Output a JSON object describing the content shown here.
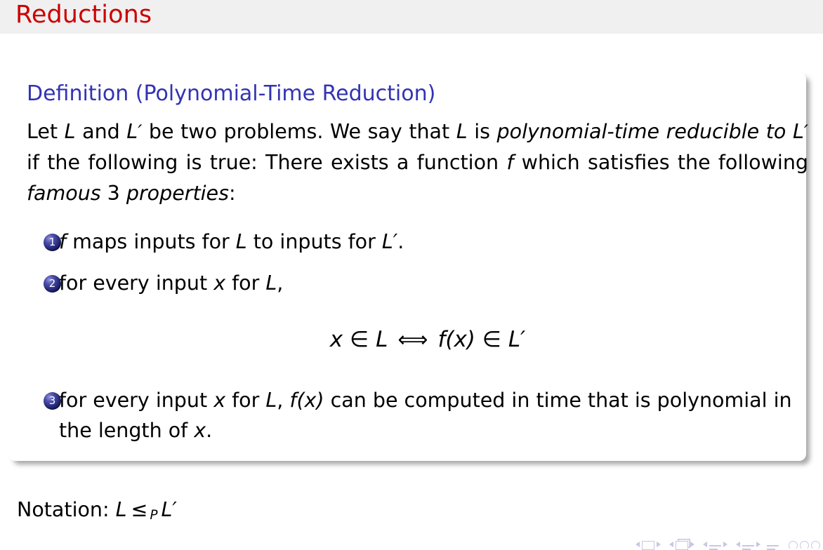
{
  "slide": {
    "title": "Reductions",
    "title_color": "#cc0000",
    "titlebar_bg": "#f0f0f0"
  },
  "block": {
    "heading": "Definition (Polynomial-Time Reduction)",
    "heading_color": "#3333b3",
    "paragraph": {
      "part1": "Let ",
      "L1": "L",
      "part2": " and ",
      "L2": "L",
      "prime2": "′",
      "part3": " be two problems.  We say that ",
      "L3": "L",
      "part4": " is ",
      "emph1": "polynomial-time reducible to",
      "part5": " ",
      "L4": "L",
      "prime4": "′",
      "part6": " if the following is true:  There exists a function ",
      "f1": "f",
      "part7": " which satisfies the following ",
      "emph2": "famous",
      "part8": " 3 ",
      "emph3": "properties",
      "part9": ":"
    },
    "items": [
      {
        "number": "1",
        "segments": [
          {
            "text": "f",
            "style": "math"
          },
          {
            "text": " maps inputs for ",
            "style": "plain"
          },
          {
            "text": "L",
            "style": "math"
          },
          {
            "text": " to inputs for ",
            "style": "plain"
          },
          {
            "text": "L′",
            "style": "math"
          },
          {
            "text": ".",
            "style": "plain"
          }
        ]
      },
      {
        "number": "2",
        "segments": [
          {
            "text": "for every input ",
            "style": "plain"
          },
          {
            "text": "x",
            "style": "math"
          },
          {
            "text": " for ",
            "style": "plain"
          },
          {
            "text": "L",
            "style": "math"
          },
          {
            "text": ",",
            "style": "plain"
          }
        ]
      },
      {
        "number": "3",
        "segments": [
          {
            "text": "for every input ",
            "style": "plain"
          },
          {
            "text": "x",
            "style": "math"
          },
          {
            "text": " for ",
            "style": "plain"
          },
          {
            "text": "L",
            "style": "math"
          },
          {
            "text": ", ",
            "style": "plain"
          },
          {
            "text": "f(x)",
            "style": "math"
          },
          {
            "text": " can be computed in time that is polynomial in the length of ",
            "style": "plain"
          },
          {
            "text": "x",
            "style": "math"
          },
          {
            "text": ".",
            "style": "plain"
          }
        ]
      }
    ],
    "equation": {
      "lhs_var": "x",
      "member1": "∈",
      "lhs_set": "L",
      "iff": "⟺",
      "rhs_fn": "f(x)",
      "member2": "∈",
      "rhs_set": "L′"
    }
  },
  "notation": {
    "label": "Notation:",
    "left": "L",
    "relation": "≤",
    "subscript": "P",
    "right": "L′"
  },
  "navigation": {
    "icons": [
      "prev-arrow-icon",
      "slide-icon",
      "next-arrow-icon",
      "prev-arrow-icon",
      "frame-stack-icon",
      "next-arrow-icon",
      "prev-arrow-icon",
      "subsection-icon",
      "next-arrow-icon",
      "prev-arrow-icon",
      "section-icon",
      "next-arrow-icon",
      "presentation-icon",
      "appendix-circles-icon"
    ]
  }
}
